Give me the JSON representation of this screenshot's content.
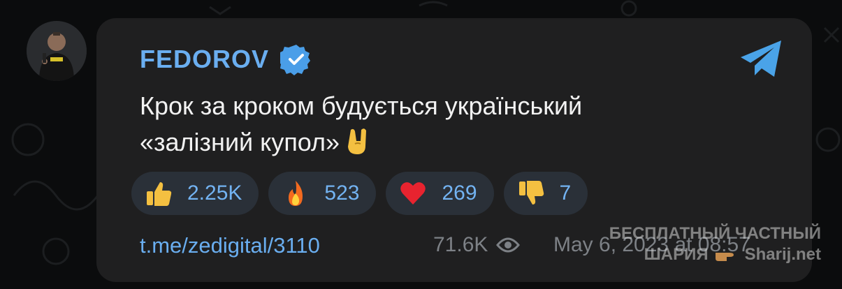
{
  "channel": {
    "name": "FEDOROV",
    "verified": true
  },
  "message": {
    "line1": "Крок за кроком будується український",
    "line2": "«залізний купол»"
  },
  "reactions": [
    {
      "icon": "thumbs-up",
      "count": "2.25K"
    },
    {
      "icon": "fire",
      "count": "523"
    },
    {
      "icon": "heart",
      "count": "269"
    },
    {
      "icon": "thumbs-down",
      "count": "7"
    }
  ],
  "footer": {
    "link": "t.me/zedigital/3110",
    "views": "71.6K",
    "date": "May 6, 2023 at 08:57"
  },
  "watermark": {
    "line1": "БЕСПЛАТНЫЙ  ЧАСТНЫЙ",
    "line2a": "ШАРИЯ",
    "line2b": "Sharij.net"
  },
  "colors": {
    "accent": "#6aaef0",
    "card": "#1f1f20",
    "reaction_bg": "#2a3038",
    "muted": "#7d8186",
    "telegram": "#4aa3e8"
  }
}
